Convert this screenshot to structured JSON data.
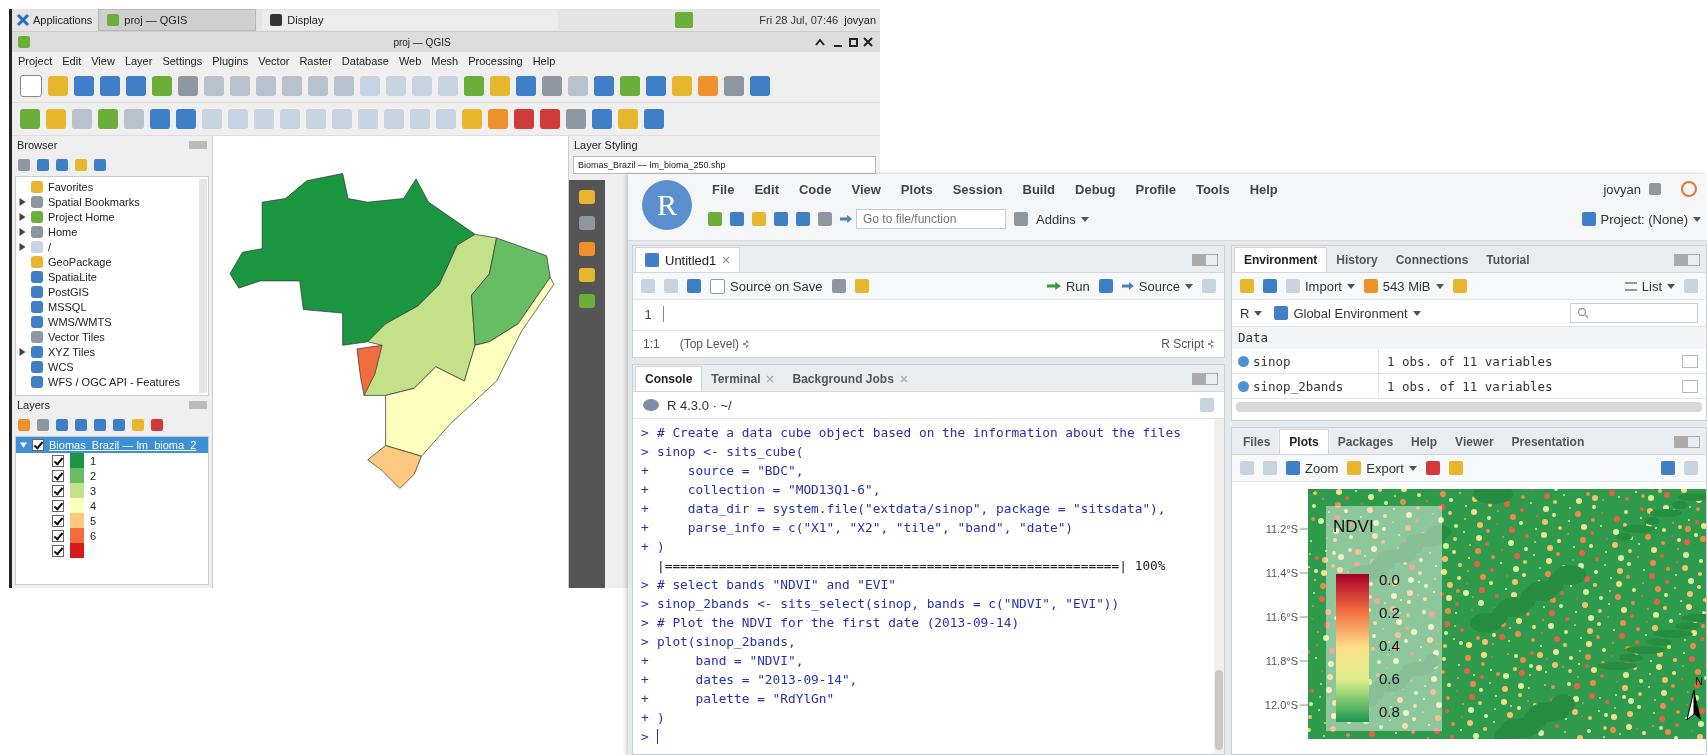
{
  "qgis": {
    "taskbar": {
      "menu": "Applications",
      "tasks": [
        {
          "label": "proj — QGIS",
          "selected": true
        },
        {
          "label": "Display",
          "selected": false
        }
      ],
      "clock": "Fri 28 Jul, 07:46",
      "user": "jovyan"
    },
    "title": "proj — QGIS",
    "menu": [
      "Project",
      "Edit",
      "View",
      "Layer",
      "Settings",
      "Plugins",
      "Vector",
      "Raster",
      "Database",
      "Web",
      "Mesh",
      "Processing",
      "Help"
    ],
    "browser": {
      "title": "Browser",
      "items": [
        {
          "label": "Favorites",
          "expandable": false
        },
        {
          "label": "Spatial Bookmarks",
          "expandable": true
        },
        {
          "label": "Project Home",
          "expandable": true
        },
        {
          "label": "Home",
          "expandable": true
        },
        {
          "label": "/",
          "expandable": true
        },
        {
          "label": "GeoPackage",
          "expandable": false
        },
        {
          "label": "SpatiaLite",
          "expandable": false
        },
        {
          "label": "PostGIS",
          "expandable": false
        },
        {
          "label": "MSSQL",
          "expandable": false
        },
        {
          "label": "WMS/WMTS",
          "expandable": false
        },
        {
          "label": "Vector Tiles",
          "expandable": false
        },
        {
          "label": "XYZ Tiles",
          "expandable": true
        },
        {
          "label": "WCS",
          "expandable": false
        },
        {
          "label": "WFS / OGC API - Features",
          "expandable": false
        }
      ]
    },
    "layers": {
      "title": "Layers",
      "layer": {
        "name": "Biomas_Brazil — lm_bioma_2",
        "checked": true,
        "selected": true,
        "expanded": true,
        "classes": [
          {
            "label": "1",
            "color": "#1a9641",
            "checked": true
          },
          {
            "label": "2",
            "color": "#66bd63",
            "checked": true
          },
          {
            "label": "3",
            "color": "#c2e188",
            "checked": true
          },
          {
            "label": "4",
            "color": "#ffffc0",
            "checked": true
          },
          {
            "label": "5",
            "color": "#fdc980",
            "checked": true
          },
          {
            "label": "6",
            "color": "#f26d3d",
            "checked": true
          },
          {
            "color": "#d7191c",
            "checked": true
          }
        ]
      }
    },
    "layer_styling": {
      "title": "Layer Styling",
      "layer": "Biomas_Brazil — lm_bioma_250.shp"
    }
  },
  "rstudio": {
    "logo": "R",
    "menu": [
      "File",
      "Edit",
      "Code",
      "View",
      "Plots",
      "Session",
      "Build",
      "Debug",
      "Profile",
      "Tools",
      "Help"
    ],
    "user": "jovyan",
    "goto_placeholder": "Go to file/function",
    "addins": "Addins",
    "project": "Project: (None)",
    "editor": {
      "tabs": [
        {
          "label": "Untitled1",
          "selected": true
        }
      ],
      "source_on_save": {
        "label": "Source on Save",
        "checked": false
      },
      "run": "Run",
      "source": "Source",
      "line_numbers": [
        "1"
      ],
      "position": "1:1",
      "scope": "(Top Level)",
      "file_type": "R Script"
    },
    "console": {
      "tabs": [
        {
          "label": "Console",
          "selected": true,
          "closable": false
        },
        {
          "label": "Terminal",
          "selected": false,
          "closable": true
        },
        {
          "label": "Background Jobs",
          "selected": false,
          "closable": true
        }
      ],
      "version": "R 4.3.0 · ~/",
      "lines": [
        {
          "kind": "command",
          "prompt": ">",
          "code": "# Create a data cube object based on the information about the files"
        },
        {
          "kind": "command",
          "prompt": ">",
          "code": "sinop <- sits_cube("
        },
        {
          "kind": "command",
          "prompt": "+",
          "code": "    source = \"BDC\","
        },
        {
          "kind": "command",
          "prompt": "+",
          "code": "    collection = \"MOD13Q1-6\","
        },
        {
          "kind": "command",
          "prompt": "+",
          "code": "    data_dir = system.file(\"extdata/sinop\", package = \"sitsdata\"),"
        },
        {
          "kind": "command",
          "prompt": "+",
          "code": "    parse_info = c(\"X1\", \"X2\", \"tile\", \"band\", \"date\")"
        },
        {
          "kind": "command",
          "prompt": "+",
          "code": ")"
        },
        {
          "kind": "output",
          "code": "|===========================================================| 100%"
        },
        {
          "kind": "command",
          "prompt": ">",
          "code": "# select bands \"NDVI\" and \"EVI\""
        },
        {
          "kind": "command",
          "prompt": ">",
          "code": "sinop_2bands <- sits_select(sinop, bands = c(\"NDVI\", \"EVI\"))"
        },
        {
          "kind": "command",
          "prompt": ">",
          "code": "# Plot the NDVI for the first date (2013-09-14)"
        },
        {
          "kind": "command",
          "prompt": ">",
          "code": "plot(sinop_2bands,"
        },
        {
          "kind": "command",
          "prompt": "+",
          "code": "     band = \"NDVI\","
        },
        {
          "kind": "command",
          "prompt": "+",
          "code": "     dates = \"2013-09-14\","
        },
        {
          "kind": "command",
          "prompt": "+",
          "code": "     palette = \"RdYlGn\""
        },
        {
          "kind": "command",
          "prompt": "+",
          "code": ")"
        },
        {
          "kind": "command",
          "prompt": ">",
          "cursor": true
        }
      ]
    },
    "environment": {
      "tabs": [
        {
          "label": "Environment",
          "selected": true
        },
        {
          "label": "History",
          "selected": false
        },
        {
          "label": "Connections",
          "selected": false
        },
        {
          "label": "Tutorial",
          "selected": false
        }
      ],
      "import": "Import",
      "memory": "543 MiB",
      "view": "List",
      "language": "R",
      "scope": "Global Environment",
      "section": "Data",
      "rows": [
        {
          "name": "sinop",
          "value": "1 obs. of 11 variables"
        },
        {
          "name": "sinop_2bands",
          "value": "1 obs. of 11 variables"
        }
      ]
    },
    "files": {
      "tabs": [
        {
          "label": "Files",
          "selected": false
        },
        {
          "label": "Plots",
          "selected": true
        },
        {
          "label": "Packages",
          "selected": false
        },
        {
          "label": "Help",
          "selected": false
        },
        {
          "label": "Viewer",
          "selected": false
        },
        {
          "label": "Presentation",
          "selected": false
        }
      ],
      "zoom": "Zoom",
      "export": "Export",
      "plot": {
        "legend_title": "NDVI",
        "legend_labels": [
          "0.0",
          "0.2",
          "0.4",
          "0.6",
          "0.8"
        ],
        "y_labels": [
          "11.2°S",
          "11.4°S",
          "11.6°S",
          "11.8°S",
          "12.0°S"
        ],
        "north": "N"
      }
    }
  }
}
